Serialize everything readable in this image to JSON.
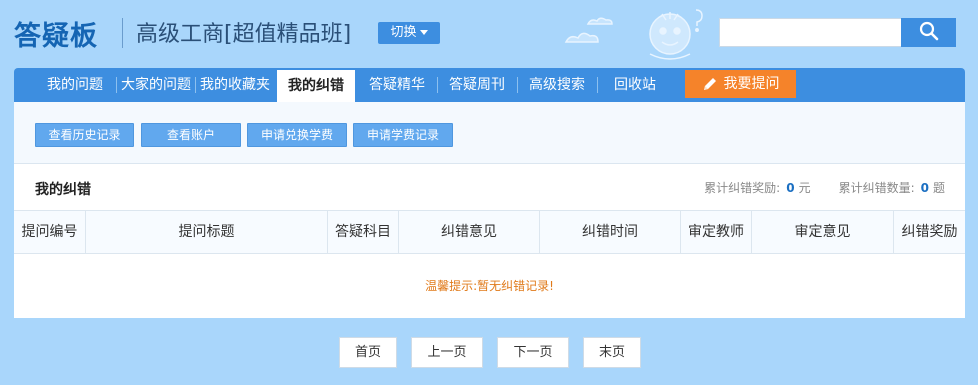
{
  "header": {
    "logo": "答疑板",
    "course_title": "高级工商[超值精品班]",
    "switch_label": "切换",
    "search_placeholder": ""
  },
  "nav": {
    "items": [
      {
        "label": "我的问题"
      },
      {
        "label": "大家的问题"
      },
      {
        "label": "我的收藏夹"
      },
      {
        "label": "我的纠错",
        "active": true
      },
      {
        "label": "答疑精华"
      },
      {
        "label": "答疑周刊"
      },
      {
        "label": "高级搜索"
      },
      {
        "label": "回收站"
      }
    ],
    "ask_label": "我要提问"
  },
  "actions": [
    {
      "label": "查看历史记录"
    },
    {
      "label": "查看账户"
    },
    {
      "label": "申请兑换学费"
    },
    {
      "label": "申请学费记录"
    }
  ],
  "section": {
    "title": "我的纠错",
    "reward_label": "累计纠错奖励:",
    "reward_value": "0",
    "reward_unit": "元",
    "count_label": "累计纠错数量:",
    "count_value": "0",
    "count_unit": "题"
  },
  "table": {
    "columns": [
      "提问编号",
      "提问标题",
      "答疑科目",
      "纠错意见",
      "纠错时间",
      "审定教师",
      "审定意见",
      "纠错奖励"
    ],
    "empty_message": "温馨提示:暂无纠错记录!"
  },
  "pagination": {
    "first": "首页",
    "prev": "上一页",
    "next": "下一页",
    "last": "末页"
  },
  "colors": {
    "page_bg": "#a9d6fb",
    "nav_bg": "#3d8ee0",
    "ask_button": "#f5832a",
    "stat_number": "#1b6fc2",
    "tip_text": "#e07a1a"
  }
}
